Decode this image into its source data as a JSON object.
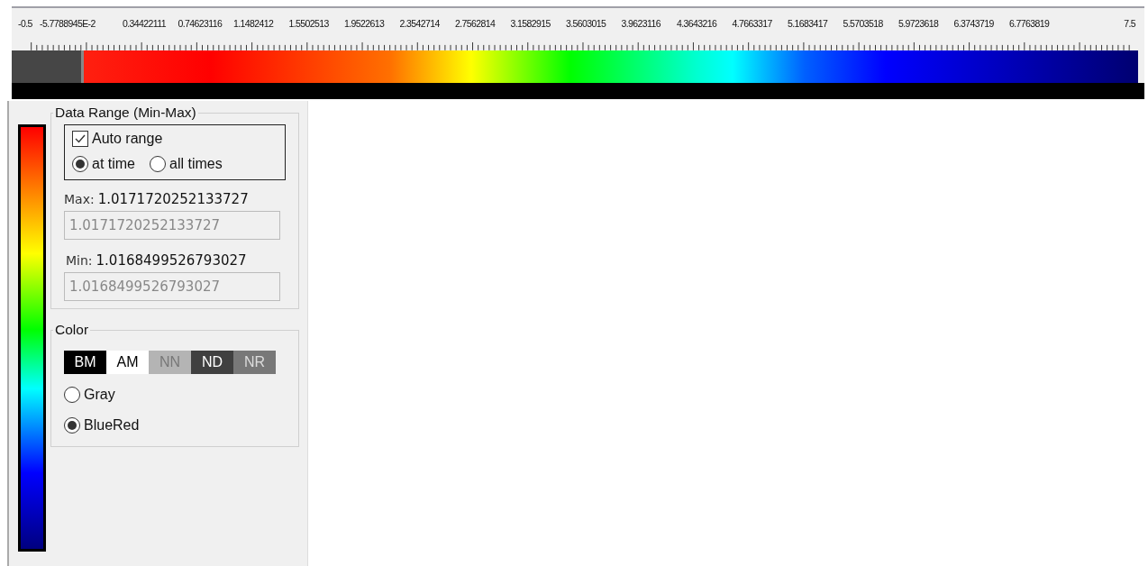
{
  "scale_labels": [
    "-0.5",
    "-5.7788945E-2",
    "0.34422111",
    "0.74623116",
    "1.1482412",
    "1.5502513",
    "1.9522613",
    "2.3542714",
    "2.7562814",
    "3.1582915",
    "3.5603015",
    "3.9623116",
    "4.3643216",
    "4.7663317",
    "5.1683417",
    "5.5703518",
    "5.9723618",
    "6.3743719",
    "6.7763819",
    "7.5"
  ],
  "data_range": {
    "title": "Data Range (Min-Max)",
    "auto_range": {
      "label": "Auto range",
      "checked": true
    },
    "modes": [
      {
        "label": "at time",
        "selected": true
      },
      {
        "label": "all times",
        "selected": false
      }
    ],
    "max": {
      "label": "Max:",
      "value": "1.0171720252133727",
      "field": "1.0171720252133727"
    },
    "min": {
      "label": "Min:",
      "value": "1.0168499526793027",
      "field": "1.0168499526793027"
    }
  },
  "color": {
    "title": "Color",
    "swatches": [
      {
        "label": "BM",
        "color": "#000000"
      },
      {
        "label": "AM",
        "color": "#ffffff"
      },
      {
        "label": "NN",
        "color": "#b4b4b4"
      },
      {
        "label": "ND",
        "color": "#404040"
      },
      {
        "label": "NR",
        "color": "#787878"
      }
    ],
    "schemes": [
      {
        "label": "Gray",
        "selected": false
      },
      {
        "label": "BlueRed",
        "selected": true
      }
    ]
  }
}
